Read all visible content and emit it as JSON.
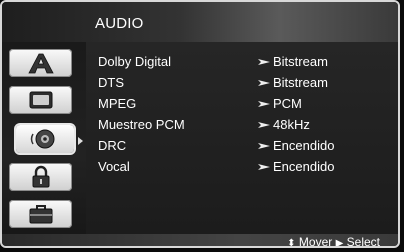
{
  "header": {
    "title": "AUDIO"
  },
  "sidebar": {
    "items": [
      {
        "icon": "letter-a-icon",
        "selected": false
      },
      {
        "icon": "tv-screen-icon",
        "selected": false
      },
      {
        "icon": "speaker-icon",
        "selected": true
      },
      {
        "icon": "lock-icon",
        "selected": false
      },
      {
        "icon": "toolbox-icon",
        "selected": false
      }
    ]
  },
  "settings": [
    {
      "label": "Dolby Digital",
      "value": "Bitstream"
    },
    {
      "label": "DTS",
      "value": "Bitstream"
    },
    {
      "label": "MPEG",
      "value": "PCM"
    },
    {
      "label": "Muestreo PCM",
      "value": "48kHz"
    },
    {
      "label": "DRC",
      "value": "Encendido"
    },
    {
      "label": "Vocal",
      "value": "Encendido"
    }
  ],
  "footer": {
    "move_glyph": "⬍",
    "move_label": "Mover",
    "select_glyph": "▶",
    "select_label": "Select"
  },
  "colors": {
    "text": "#ffffff",
    "icon_tile": "#e6e6e6",
    "background": "#141414"
  }
}
